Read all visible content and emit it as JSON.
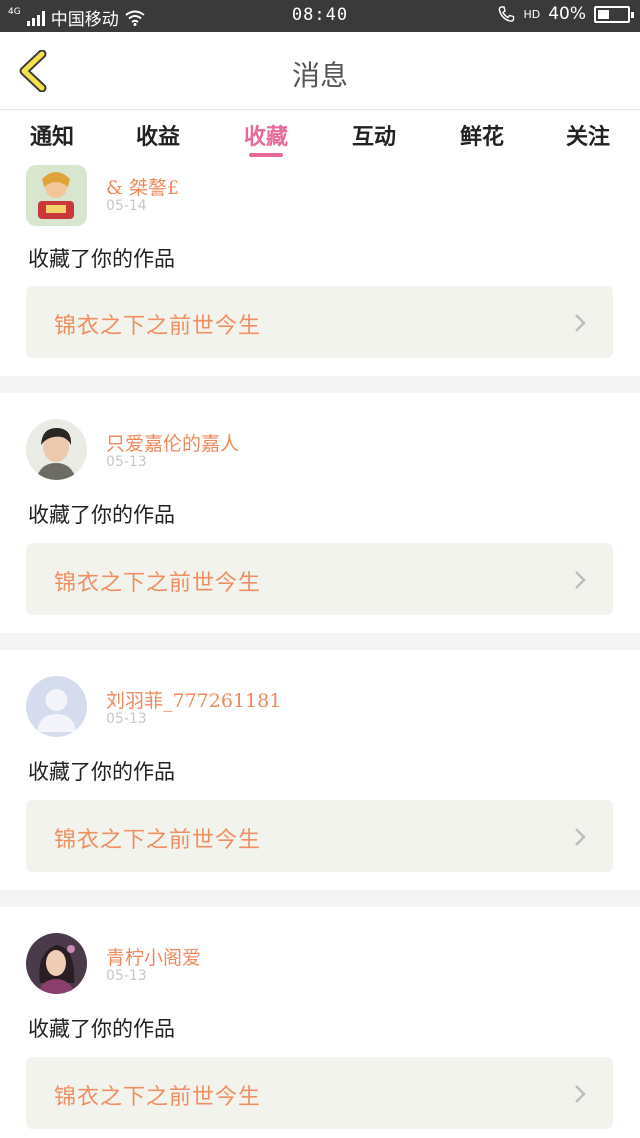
{
  "status": {
    "network": "4G",
    "carrier": "中国移动",
    "time": "08:40",
    "hd": "HD",
    "battery_text": "40%",
    "battery_level": 0.4
  },
  "header": {
    "title": "消息"
  },
  "tabs": [
    {
      "label": "通知",
      "active": false
    },
    {
      "label": "收益",
      "active": false
    },
    {
      "label": "收藏",
      "active": true
    },
    {
      "label": "互动",
      "active": false
    },
    {
      "label": "鲜花",
      "active": false
    },
    {
      "label": "关注",
      "active": false
    }
  ],
  "items": [
    {
      "username": "& 桀謷£",
      "date": "05-14",
      "message": "收藏了你的作品",
      "work_title": "锦衣之下之前世今生"
    },
    {
      "username": "只爱嘉伦的嘉人",
      "date": "05-13",
      "message": "收藏了你的作品",
      "work_title": "锦衣之下之前世今生"
    },
    {
      "username": "刘羽菲_777261181",
      "date": "05-13",
      "message": "收藏了你的作品",
      "work_title": "锦衣之下之前世今生"
    },
    {
      "username": "青柠小阁爱",
      "date": "05-13",
      "message": "收藏了你的作品",
      "work_title": "锦衣之下之前世今生"
    }
  ],
  "colors": {
    "accent_tab": "#e66a9c",
    "username": "#ee8a5c",
    "work_title": "#ef8f62",
    "work_bg": "#f3f3ee"
  }
}
